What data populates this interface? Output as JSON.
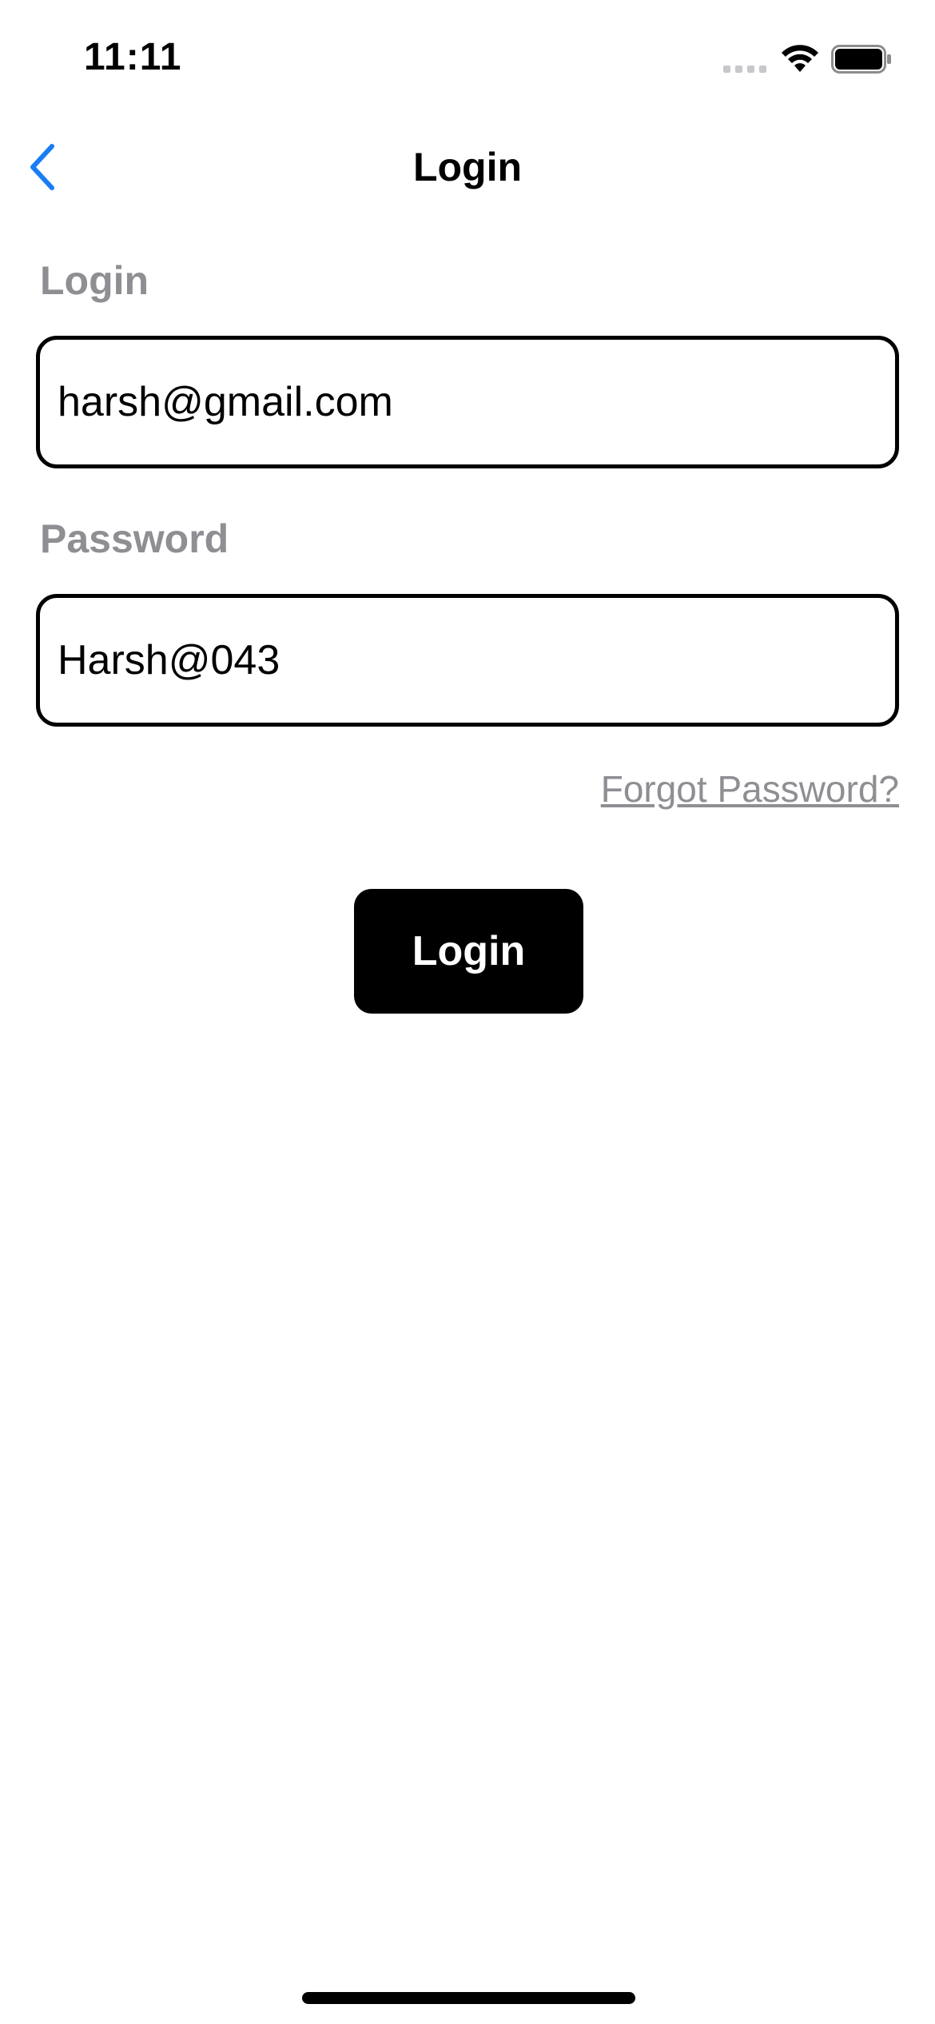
{
  "status_bar": {
    "time": "11:11",
    "icons": [
      "cellular-signal-icon",
      "wifi-icon",
      "battery-icon"
    ]
  },
  "nav": {
    "title": "Login",
    "back_icon": "chevron-left-icon",
    "accent_color": "#1a7cf5"
  },
  "form": {
    "login_label": "Login",
    "login_value": "harsh@gmail.com",
    "password_label": "Password",
    "password_value": "Harsh@043",
    "forgot_password": "Forgot Password?",
    "submit_label": "Login"
  },
  "colors": {
    "label_gray": "#8e8e93",
    "button_bg": "#000000",
    "button_text": "#ffffff"
  }
}
